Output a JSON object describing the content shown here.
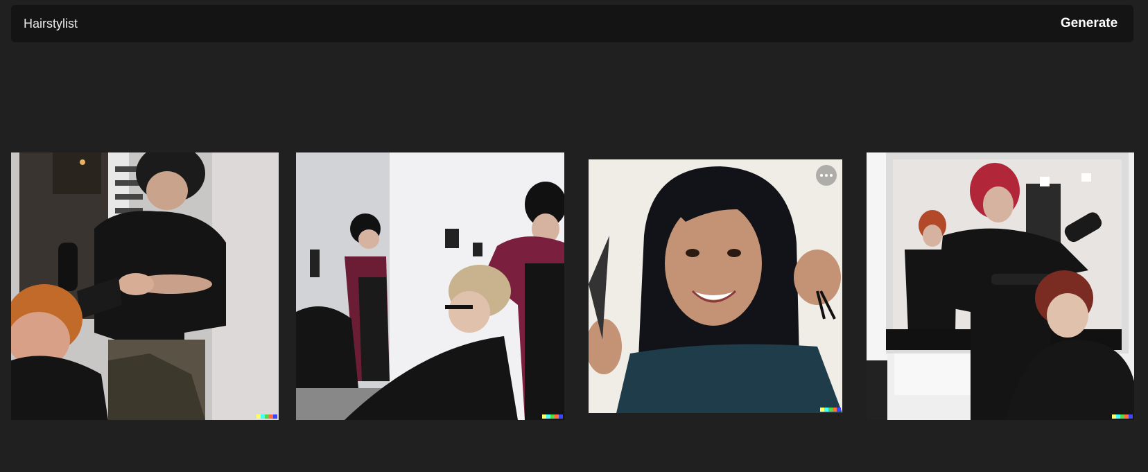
{
  "prompt": {
    "text": "Hairstylist",
    "generate_label": "Generate"
  },
  "results": [
    {
      "name": "result-image-1",
      "icon": "hairstylist-blow-dry-photo",
      "hover": false
    },
    {
      "name": "result-image-2",
      "icon": "hairstylist-salon-mirror-photo",
      "hover": false
    },
    {
      "name": "result-image-3",
      "icon": "smiling-woman-scissors-photo",
      "hover": true
    },
    {
      "name": "result-image-4",
      "icon": "hairstylist-red-hair-photo",
      "hover": false
    }
  ],
  "signature_colors": [
    "#ffff66",
    "#42ffff",
    "#51da4c",
    "#ff6e3c",
    "#3c46ff"
  ]
}
